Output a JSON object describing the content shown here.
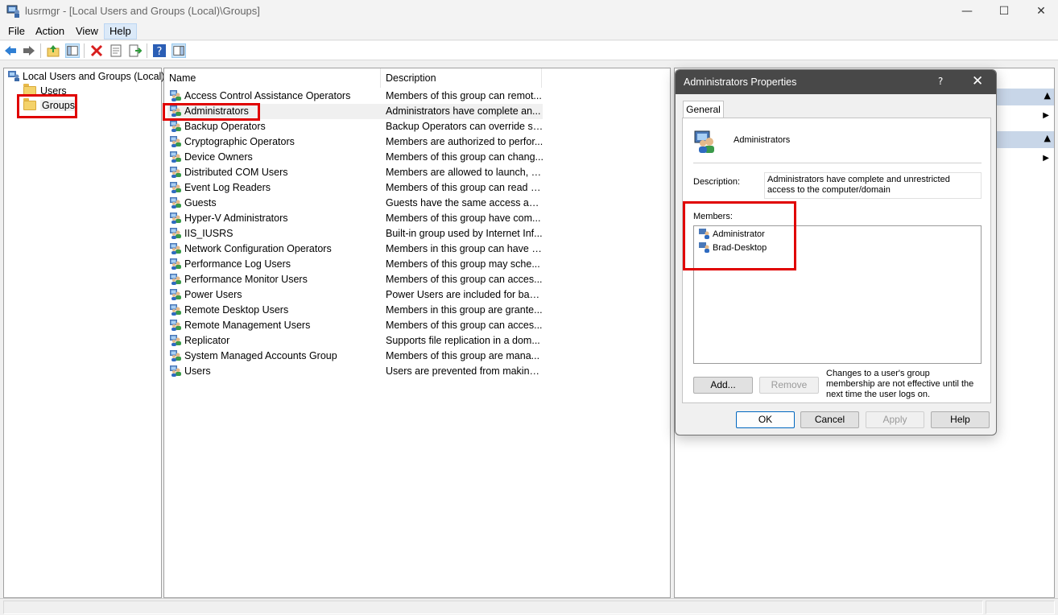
{
  "window": {
    "title": "lusrmgr - [Local Users and Groups (Local)\\Groups]"
  },
  "menu": [
    {
      "label": "File"
    },
    {
      "label": "Action"
    },
    {
      "label": "View"
    },
    {
      "label": "Help"
    }
  ],
  "tree": {
    "root": "Local Users and Groups (Local)",
    "users": "Users",
    "groups": "Groups"
  },
  "list": {
    "col_name": "Name",
    "col_desc": "Description",
    "rows": [
      {
        "name": "Access Control Assistance Operators",
        "desc": "Members of this group can remot..."
      },
      {
        "name": "Administrators",
        "desc": "Administrators have complete an..."
      },
      {
        "name": "Backup Operators",
        "desc": "Backup Operators can override se..."
      },
      {
        "name": "Cryptographic Operators",
        "desc": "Members are authorized to perfor..."
      },
      {
        "name": "Device Owners",
        "desc": "Members of this group can chang..."
      },
      {
        "name": "Distributed COM Users",
        "desc": "Members are allowed to launch, a..."
      },
      {
        "name": "Event Log Readers",
        "desc": "Members of this group can read e..."
      },
      {
        "name": "Guests",
        "desc": "Guests have the same access as m..."
      },
      {
        "name": "Hyper-V Administrators",
        "desc": "Members of this group have com..."
      },
      {
        "name": "IIS_IUSRS",
        "desc": "Built-in group used by Internet Inf..."
      },
      {
        "name": "Network Configuration Operators",
        "desc": "Members in this group can have s..."
      },
      {
        "name": "Performance Log Users",
        "desc": "Members of this group may sche..."
      },
      {
        "name": "Performance Monitor Users",
        "desc": "Members of this group can acces..."
      },
      {
        "name": "Power Users",
        "desc": "Power Users are included for back..."
      },
      {
        "name": "Remote Desktop Users",
        "desc": "Members in this group are grante..."
      },
      {
        "name": "Remote Management Users",
        "desc": "Members of this group can acces..."
      },
      {
        "name": "Replicator",
        "desc": "Supports file replication in a dom..."
      },
      {
        "name": "System Managed Accounts Group",
        "desc": "Members of this group are mana..."
      },
      {
        "name": "Users",
        "desc": "Users are prevented from making ..."
      }
    ]
  },
  "dialog": {
    "title": "Administrators Properties",
    "help_glyph": "?",
    "close_glyph": "✕",
    "tab": "General",
    "group_name": "Administrators",
    "description_label": "Description:",
    "description_value": "Administrators have complete and unrestricted access to the computer/domain",
    "members_label": "Members:",
    "members": [
      "Administrator",
      "Brad-Desktop"
    ],
    "add": "Add...",
    "remove": "Remove",
    "note": "Changes to a user's group membership are not effective until the next time the user logs on.",
    "ok": "OK",
    "cancel": "Cancel",
    "apply": "Apply",
    "help": "Help"
  },
  "colors": {
    "highlight": "#e00000",
    "actions_header": "#c8d6e8",
    "dialog_title": "#484848"
  }
}
